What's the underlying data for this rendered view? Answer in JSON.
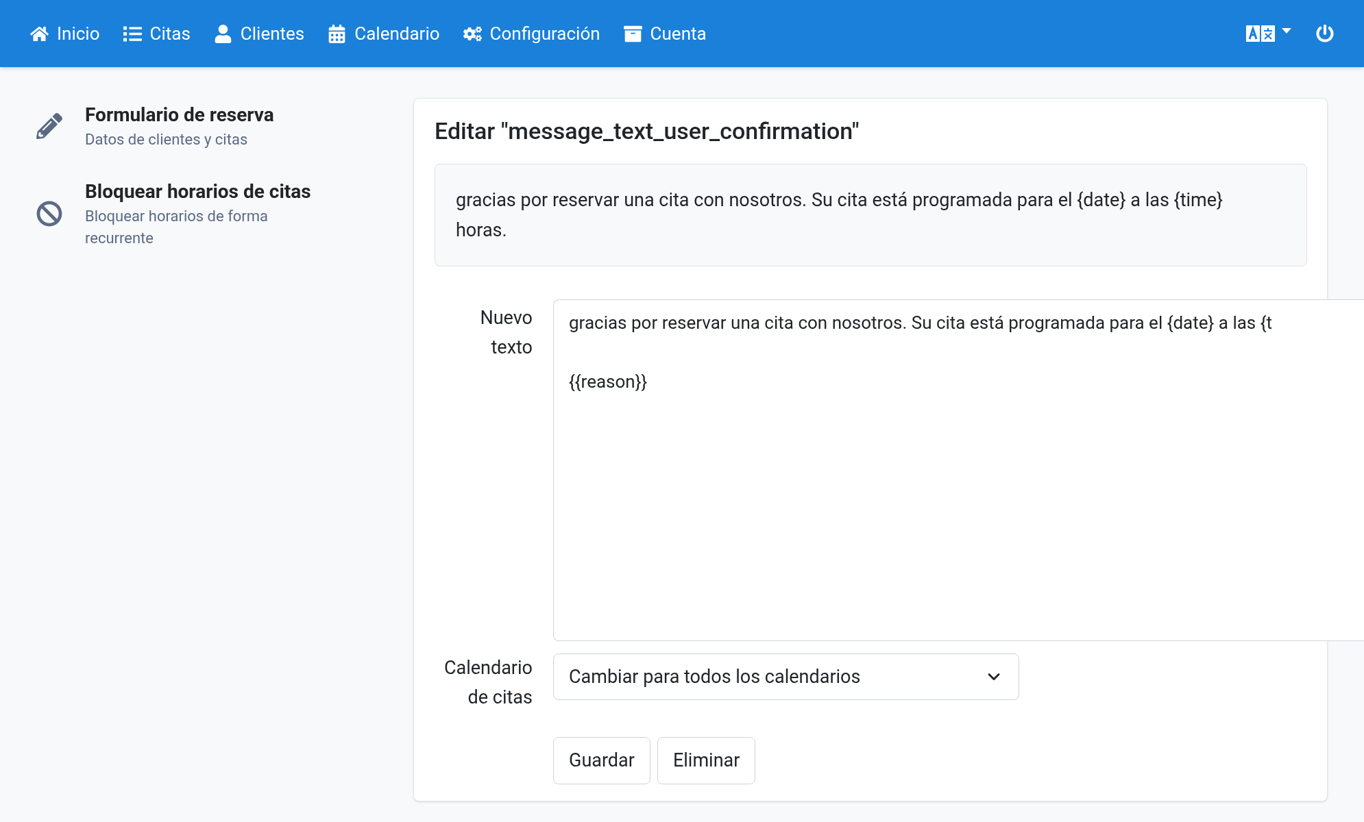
{
  "nav": {
    "items": [
      {
        "label": "Inicio"
      },
      {
        "label": "Citas"
      },
      {
        "label": "Clientes"
      },
      {
        "label": "Calendario"
      },
      {
        "label": "Configuración"
      },
      {
        "label": "Cuenta"
      }
    ]
  },
  "sidebar": {
    "items": [
      {
        "title": "Formulario de reserva",
        "subtitle": "Datos de clientes y citas"
      },
      {
        "title": "Bloquear horarios de citas",
        "subtitle": "Bloquear horarios de forma recurrente"
      }
    ]
  },
  "editor": {
    "title": "Editar \"message_text_user_confirmation\"",
    "current_text": "gracias por reservar una cita con nosotros. Su cita está programada para el {date} a las {time} horas.",
    "new_text_label": "Nuevo texto",
    "new_text_value": "gracias por reservar una cita con nosotros. Su cita está programada para el {date} a las {t\n\n{{reason}}",
    "calendar_label": "Calendario de citas",
    "calendar_value": "Cambiar para todos los calendarios",
    "buttons": [
      "Guardar",
      "Eliminar"
    ]
  }
}
